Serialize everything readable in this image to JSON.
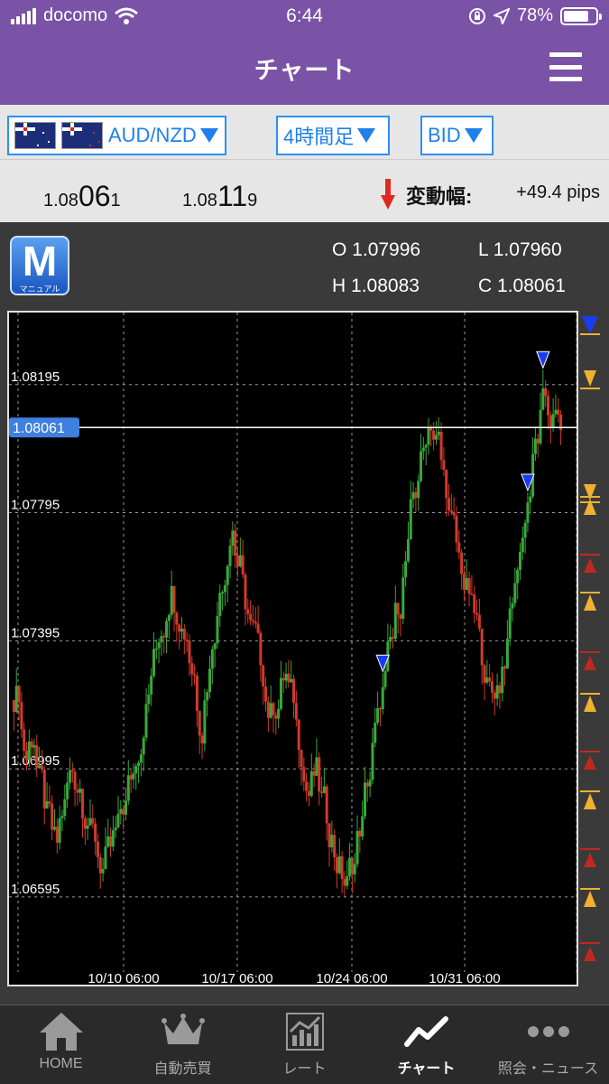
{
  "status_bar": {
    "carrier": "docomo",
    "time": "6:44",
    "battery": "78%",
    "battery_level": 0.78
  },
  "header": {
    "title": "チャート"
  },
  "selectors": {
    "pair": "AUD/NZD",
    "timeframe": "4時間足",
    "price_type": "BID"
  },
  "quote": {
    "bid_prefix": "1.08",
    "bid_big": "06",
    "bid_suffix": "1",
    "ask_prefix": "1.08",
    "ask_big": "11",
    "ask_suffix": "9",
    "change_label": "変動幅:",
    "change_value": "+49.4 pips"
  },
  "chart_header": {
    "mode_letter": "M",
    "mode_label": "マニュアル",
    "o_label": "O",
    "o_value": "1.07996",
    "h_label": "H",
    "h_value": "1.08083",
    "l_label": "L",
    "l_value": "1.07960",
    "c_label": "C",
    "c_value": "1.08061"
  },
  "chart_data": {
    "type": "candlestick",
    "y_ticks": [
      "1.08195",
      "1.07795",
      "1.07395",
      "1.06995",
      "1.06595"
    ],
    "y_tick_values": [
      1.08195,
      1.07795,
      1.07395,
      1.06995,
      1.06595
    ],
    "current_price": "1.08061",
    "x_ticks": [
      "10/10 06:00",
      "10/17 06:00",
      "10/24 06:00",
      "10/31 06:00"
    ],
    "ylim": [
      1.064,
      1.0842
    ],
    "grid": true,
    "colors": {
      "up": "#3aa83a",
      "down": "#d23a2a",
      "sell_marker": "#1a3cf0",
      "side_up": "#f0b030",
      "side_down": "#c0281e"
    },
    "close_path": [
      1.0725,
      1.07,
      1.0712,
      1.069,
      1.068,
      1.0672,
      1.069,
      1.07,
      1.0695,
      1.0685,
      1.0675,
      1.0668,
      1.0672,
      1.068,
      1.069,
      1.07,
      1.0712,
      1.0725,
      1.0738,
      1.0748,
      1.076,
      1.075,
      1.0742,
      1.0728,
      1.0712,
      1.0735,
      1.0752,
      1.0765,
      1.078,
      1.076,
      1.0745,
      1.0738,
      1.0728,
      1.0715,
      1.0722,
      1.073,
      1.0718,
      1.0705,
      1.069,
      1.0698,
      1.0685,
      1.0678,
      1.0668,
      1.0662,
      1.0672,
      1.0685,
      1.07,
      1.0715,
      1.0728,
      1.074,
      1.0755,
      1.077,
      1.0788,
      1.08,
      1.0812,
      1.08,
      1.0785,
      1.077,
      1.076,
      1.0752,
      1.0742,
      1.073,
      1.072,
      1.0728,
      1.074,
      1.0758,
      1.0775,
      1.079,
      1.0805,
      1.0815,
      1.0808,
      1.0806
    ],
    "sell_markers_index": [
      48,
      67,
      69
    ]
  },
  "tabs": [
    {
      "label": "HOME",
      "icon": "home-icon"
    },
    {
      "label": "自動売買",
      "icon": "crown-icon"
    },
    {
      "label": "レート",
      "icon": "rate-chart-icon"
    },
    {
      "label": "チャート",
      "icon": "chart-line-icon"
    },
    {
      "label": "照会・ニュース",
      "icon": "more-dots-icon"
    }
  ]
}
